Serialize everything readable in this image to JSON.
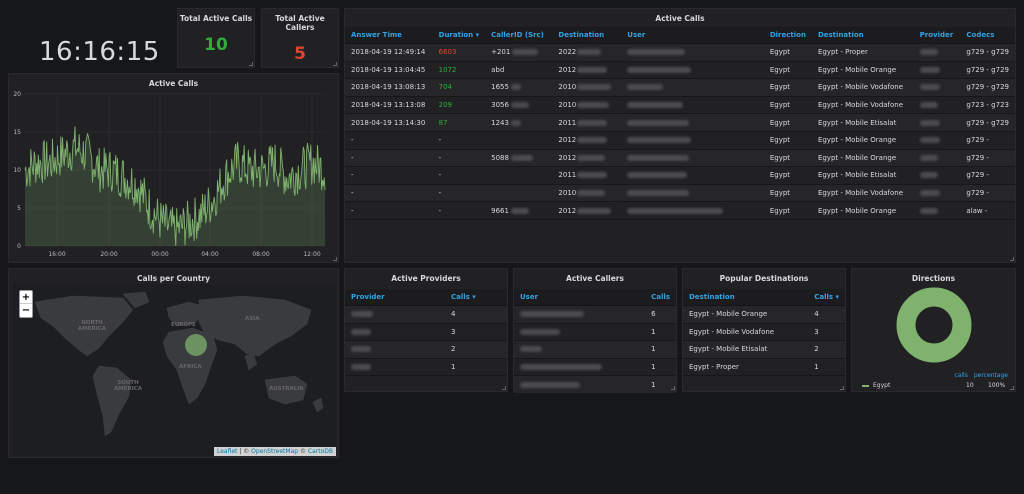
{
  "clock": {
    "time": "16:16:15"
  },
  "stats": [
    {
      "title": "Total Active Calls",
      "value": "10",
      "color": "#2fad3d"
    },
    {
      "title": "Total Active Callers",
      "value": "5",
      "color": "#e0452f"
    }
  ],
  "active_calls": {
    "title": "Active Calls",
    "columns": [
      "Answer Time",
      "Duration ▾",
      "CallerID (Src)",
      "Destination",
      "User",
      "Direction",
      "Destination",
      "Provider",
      "Codecs"
    ],
    "rows": [
      {
        "time": "2018-04-19 12:49:14",
        "duration": "6603",
        "dur_color": "red",
        "caller": "+201",
        "dest": "2022",
        "direction": "Egypt",
        "destination": "Egypt - Proper",
        "codecs": "g729 - g729"
      },
      {
        "time": "2018-04-19 13:04:45",
        "duration": "1072",
        "dur_color": "green",
        "caller": "abd",
        "dest": "2012",
        "direction": "Egypt",
        "destination": "Egypt - Mobile Orange",
        "codecs": "g729 - g729"
      },
      {
        "time": "2018-04-19 13:08:13",
        "duration": "704",
        "dur_color": "green",
        "caller": "1655",
        "dest": "2010",
        "direction": "Egypt",
        "destination": "Egypt - Mobile Vodafone",
        "codecs": "g729 - g729"
      },
      {
        "time": "2018-04-19 13:13:08",
        "duration": "209",
        "dur_color": "green",
        "caller": "3056",
        "dest": "2010",
        "direction": "Egypt",
        "destination": "Egypt - Mobile Vodafone",
        "codecs": "g723 - g723"
      },
      {
        "time": "2018-04-19 13:14:30",
        "duration": "87",
        "dur_color": "green",
        "caller": "1243",
        "dest": "2011",
        "direction": "Egypt",
        "destination": "Egypt - Mobile Etisalat",
        "codecs": "g729 - g729"
      },
      {
        "time": "-",
        "duration": "-",
        "dur_color": "",
        "caller": "",
        "dest": "2012",
        "direction": "Egypt",
        "destination": "Egypt - Mobile Orange",
        "codecs": "g729 -"
      },
      {
        "time": "-",
        "duration": "-",
        "dur_color": "",
        "caller": "5088",
        "dest": "2012",
        "direction": "Egypt",
        "destination": "Egypt - Mobile Orange",
        "codecs": "g729 -"
      },
      {
        "time": "-",
        "duration": "-",
        "dur_color": "",
        "caller": "",
        "dest": "2011",
        "direction": "Egypt",
        "destination": "Egypt - Mobile Etisalat",
        "codecs": "g729 -"
      },
      {
        "time": "-",
        "duration": "-",
        "dur_color": "",
        "caller": "",
        "dest": "2010",
        "direction": "Egypt",
        "destination": "Egypt - Mobile Vodafone",
        "codecs": "g729 -"
      },
      {
        "time": "-",
        "duration": "-",
        "dur_color": "",
        "caller": "9661",
        "dest": "2012",
        "direction": "Egypt",
        "destination": "Egypt - Mobile Orange",
        "codecs": "alaw -"
      }
    ]
  },
  "graph": {
    "title": "Active Calls",
    "y_ticks": [
      "0",
      "5",
      "10",
      "15",
      "20"
    ],
    "x_ticks": [
      "16:00",
      "20:00",
      "00:00",
      "04:00",
      "08:00",
      "12:00"
    ]
  },
  "chart_data": {
    "type": "area",
    "title": "Active Calls",
    "ylim": [
      0,
      20
    ],
    "x": [
      "14:00",
      "15:00",
      "16:00",
      "17:00",
      "18:00",
      "19:00",
      "20:00",
      "21:00",
      "22:00",
      "23:00",
      "00:00",
      "01:00",
      "02:00",
      "03:00",
      "04:00",
      "05:00",
      "06:00",
      "07:00",
      "08:00",
      "09:00",
      "10:00",
      "11:00",
      "12:00",
      "13:00",
      "14:00"
    ],
    "series": [
      {
        "values": [
          10,
          11,
          11,
          12,
          13,
          12,
          10,
          10,
          9,
          8,
          5,
          3,
          2,
          3,
          4,
          6,
          9,
          11,
          10,
          10,
          11,
          9,
          10,
          11,
          10
        ]
      }
    ]
  },
  "map": {
    "title": "Calls per Country",
    "zoom_in": "+",
    "zoom_out": "−",
    "labels": [
      "NORTH AMERICA",
      "EUROPE",
      "ASIA",
      "AFRICA",
      "SOUTH AMERICA",
      "AUSTRALIA"
    ],
    "attribution_leaflet": "Leaflet",
    "attribution_sep": " | © ",
    "attribution_osm": "OpenStreetMap",
    "attribution_sep2": " © ",
    "attribution_carto": "CartoDB"
  },
  "providers": {
    "title": "Active Providers",
    "columns": [
      "Provider",
      "Calls ▾"
    ],
    "calls": [
      "4",
      "3",
      "2",
      "1"
    ]
  },
  "callers": {
    "title": "Active Callers",
    "columns": [
      "User",
      "Calls"
    ],
    "calls": [
      "6",
      "1",
      "1",
      "1",
      "1"
    ]
  },
  "popular": {
    "title": "Popular Destinations",
    "columns": [
      "Destination",
      "Calls ▾"
    ],
    "rows": [
      {
        "dest": "Egypt - Mobile Orange",
        "calls": "4"
      },
      {
        "dest": "Egypt - Mobile Vodafone",
        "calls": "3"
      },
      {
        "dest": "Egypt - Mobile Etisalat",
        "calls": "2"
      },
      {
        "dest": "Egypt - Proper",
        "calls": "1"
      }
    ]
  },
  "directions": {
    "title": "Directions",
    "legend_headers": [
      "calls",
      "percentage"
    ],
    "legend": [
      {
        "name": "Egypt",
        "calls": "10",
        "percentage": "100%"
      }
    ],
    "color": "#7eb26d"
  }
}
